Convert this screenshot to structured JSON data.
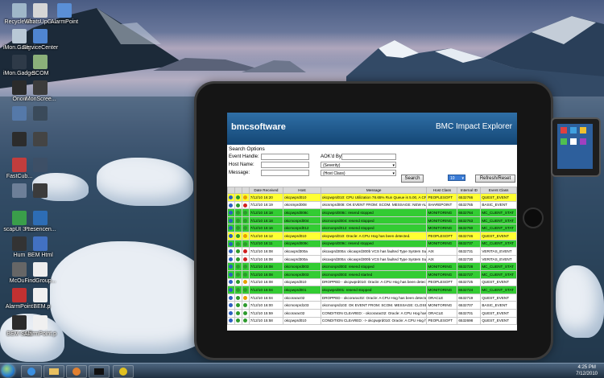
{
  "desktop": {
    "icons": [
      {
        "label": "Recycle Bin",
        "color": "#9fb7c9"
      },
      {
        "label": "WhatsUpG...",
        "color": "#d6d6d6"
      },
      {
        "label": "AlarmPoint",
        "color": "#5a8fd6"
      },
      {
        "label": "iMon.Gadg...",
        "color": "#b9c8d6"
      },
      {
        "label": "ServiceCenter",
        "color": "#4f85d1"
      },
      {
        "label": "iMon.Gadget",
        "color": "#2e3a48"
      },
      {
        "label": "SCOM",
        "color": "#8bb07a"
      },
      {
        "label": "Onon",
        "color": "#2b2b2b"
      },
      {
        "label": "iMonScree...",
        "color": "#3c3c3c"
      },
      {
        "label": "",
        "color": "#5579a9"
      },
      {
        "label": "",
        "color": "#3a4a5a"
      },
      {
        "label": "",
        "color": "#2c2c2c"
      },
      {
        "label": "",
        "color": "#444444"
      },
      {
        "label": "FastCub...",
        "color": "#c23d3d"
      },
      {
        "label": "",
        "color": "#3d4f66"
      },
      {
        "label": "",
        "color": "#6d7f98"
      },
      {
        "label": "",
        "color": "#3b3b3b"
      },
      {
        "label": "scapUI 3.1...",
        "color": "#3a9e4a"
      },
      {
        "label": "Presencen...",
        "color": "#2d6db5"
      },
      {
        "label": "Hum",
        "color": "#333333"
      },
      {
        "label": "BEM Html",
        "color": "#4271c2"
      },
      {
        "label": "McOu...",
        "color": "#666666"
      },
      {
        "label": "FindGroup...",
        "color": "#eeeeee"
      },
      {
        "label": "AlarmPoint",
        "color": "#c23131"
      },
      {
        "label": "..BEM.p",
        "color": "#f0f0f0"
      },
      {
        "label": "BEM Stuff",
        "color": "#2b2b2b"
      },
      {
        "label": "AlarmPoint.p",
        "color": "#f0f0f0"
      }
    ]
  },
  "app": {
    "logo": "bmcsoftware",
    "title": "BMC Impact Explorer",
    "search": {
      "heading": "Search Options",
      "event_handle_label": "Event Handle:",
      "host_name_label": "Host Name:",
      "message_label": "Message:",
      "acked_by_label": "AOK'd By:",
      "severity_value": "(Severity)",
      "host_class_value": "(Host Class)",
      "search_button": "Search",
      "refresh_button": "Refresh/Reset",
      "count_value": "10"
    },
    "columns": [
      "",
      "",
      "",
      "Date Received",
      "Host",
      "Message",
      "Host Class",
      "Internal ID",
      "Event Class"
    ],
    "rows": [
      {
        "date": "7/12/10 16:20",
        "host": "okcpwprd010",
        "message": "okcpwprd010: CPU Utilization 78.65% Run Queue is 5.00, A CPU...",
        "hclass": "PEOPLESOFT",
        "id": "6532766",
        "eclass": "QUEST_EVENT",
        "bg": "#ffff33",
        "sev": "#e8a000"
      },
      {
        "date": "7/12/10 16:19",
        "host": "okcsmprd008",
        "message": "okcsmprd008: OK EVENT FROM: SCOM. MESSAGE: NEW ALERT...",
        "hclass": "SHAREPOINT",
        "id": "6532765",
        "eclass": "BASIC_EVENT",
        "bg": "#ffffff",
        "sev": "#d02020"
      },
      {
        "date": "7/12/10 16:18",
        "host": "okcpwprd008c",
        "message": "okcpwprd008c: resend stopped",
        "hclass": "MONITORING",
        "id": "6532764",
        "eclass": "MC_CLIENT_STAT",
        "bg": "#33cc33",
        "sev": "#2d9a2d"
      },
      {
        "date": "7/12/10 16:18",
        "host": "okcmonprd004",
        "message": "okcmonprd004: resend stopped",
        "hclass": "MONITORING",
        "id": "6532763",
        "eclass": "MC_CLIENT_STAT",
        "bg": "#33cc33",
        "sev": "#2d9a2d"
      },
      {
        "date": "7/12/10 16:16",
        "host": "okcmonprd012",
        "message": "okcmonprd012: resend stopped",
        "hclass": "MONITORING",
        "id": "6532760",
        "eclass": "MC_CLIENT_STAT",
        "bg": "#33cc33",
        "sev": "#2d9a2d"
      },
      {
        "date": "7/12/10 16:12",
        "host": "okcpwprd010",
        "message": "okcpwprd010: Oracle: A CPU Hog has been detected.",
        "hclass": "PEOPLESOFT",
        "id": "6532746",
        "eclass": "QUEST_EVENT",
        "bg": "#ffff33",
        "sev": "#e8a000"
      },
      {
        "date": "7/12/10 16:11",
        "host": "okcpwprd009c",
        "message": "okcpwprd009c: resend stopped",
        "hclass": "MONITORING",
        "id": "6532737",
        "eclass": "MC_CLIENT_STAT",
        "bg": "#33cc33",
        "sev": "#2d9a2d"
      },
      {
        "date": "7/12/10 16:08",
        "host": "okcaxprd300a",
        "message": "okcaxprd300a: okcaxprd300b VCS has faulted Type System Su...",
        "hclass": "AIX",
        "id": "6532731",
        "eclass": "VERITAS_EVENT",
        "bg": "#ffffff",
        "sev": "#d02020"
      },
      {
        "date": "7/12/10 16:08",
        "host": "okcaxprd300a",
        "message": "okcaxprd300a: okcaxprd300b VCS has faulted Type System Su...",
        "hclass": "AIX",
        "id": "6532730",
        "eclass": "VERITAS_EVENT",
        "bg": "#ffffff",
        "sev": "#d02020"
      },
      {
        "date": "7/12/10 16:08",
        "host": "okcmonprd003",
        "message": "okcmonprd003: resend stopped",
        "hclass": "MONITORING",
        "id": "6532728",
        "eclass": "MC_CLIENT_STAT",
        "bg": "#33cc33",
        "sev": "#2d9a2d"
      },
      {
        "date": "7/12/10 16:08",
        "host": "okcmonprd003",
        "message": "okcmonprd003: resend started",
        "hclass": "MONITORING",
        "id": "6532727",
        "eclass": "MC_CLIENT_STAT",
        "bg": "#33cc33",
        "sev": "#2d9a2d"
      },
      {
        "date": "7/12/10 16:08",
        "host": "okcpwprd010",
        "message": "DROPPED - okcpwprd010: Oracle: A CPU Hog has been detected.",
        "hclass": "PEOPLESOFT",
        "id": "6532725",
        "eclass": "QUEST_EVENT",
        "bg": "#ffffff",
        "sev": "#e8a000"
      },
      {
        "date": "7/12/10 16:04",
        "host": "okcpwprd001",
        "message": "okcpwprd001: resend stopped",
        "hclass": "MONITORING",
        "id": "6532724",
        "eclass": "MC_CLIENT_STAT",
        "bg": "#33cc33",
        "sev": "#2d9a2d"
      },
      {
        "date": "7/12/10 16:04",
        "host": "okcorarac02",
        "message": "DROPPED - okcorarac02: Oracle: A CPU Hog has been detected.",
        "hclass": "ORACLE",
        "id": "6532719",
        "eclass": "QUEST_EVENT",
        "bg": "#ffffff",
        "sev": "#e8a000"
      },
      {
        "date": "7/12/10 16:00",
        "host": "okcmonprd103",
        "message": "okcmonprd103: OK EVENT FROM: SCOM. MESSAGE: CLOSED AL...",
        "hclass": "MONITORING",
        "id": "6532707",
        "eclass": "BASIC_EVENT",
        "bg": "#ffffff",
        "sev": "#2d9a2d"
      },
      {
        "date": "7/12/10 15:59",
        "host": "okcorarac02",
        "message": "CONDITION CLEARED: - okcorarac02: Oracle: A CPU Hog has b...",
        "hclass": "ORACLE",
        "id": "6532701",
        "eclass": "QUEST_EVENT",
        "bg": "#ffffff",
        "sev": "#2d9a2d"
      },
      {
        "date": "7/12/10 15:58",
        "host": "okcpwprd010",
        "message": "CONDITION CLEARED: -> okcpwprd010: Oracle: A CPU Hog has...",
        "hclass": "PEOPLESOFT",
        "id": "6532698",
        "eclass": "QUEST_EVENT",
        "bg": "#ffffff",
        "sev": "#2d9a2d"
      }
    ]
  },
  "taskbar": {
    "time": "4:25 PM",
    "date": "7/12/2010"
  }
}
